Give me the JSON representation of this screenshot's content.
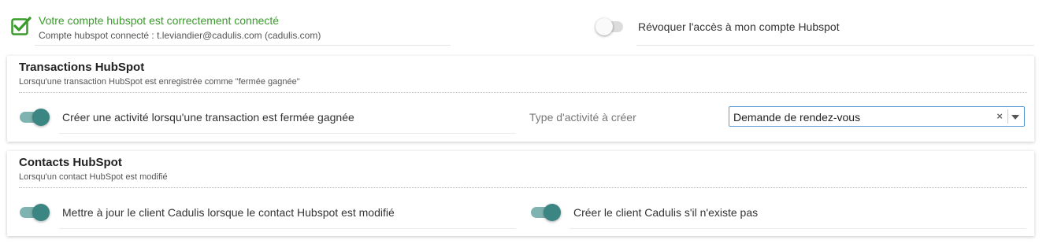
{
  "connection": {
    "status_text": "Votre compte hubspot est correctement connecté",
    "account_text": "Compte hubspot connecté : t.leviandier@cadulis.com (cadulis.com)",
    "status_color": "#3a9a2c",
    "revoke_label": "Révoquer l'accès à mon compte Hubspot",
    "revoke_toggle_on": false
  },
  "transactions": {
    "title": "Transactions HubSpot",
    "subtitle": "Lorsqu'une transaction HubSpot est enregistrée comme \"fermée gagnée\"",
    "create_activity_label": "Créer une activité lorsqu'une transaction est fermée gagnée",
    "create_activity_on": true,
    "activity_type_label": "Type d'activité à créer",
    "activity_type_value": "Demande de rendez-vous",
    "clear_icon": "close-icon",
    "dropdown_icon": "chevron-down-icon"
  },
  "contacts": {
    "title": "Contacts HubSpot",
    "subtitle": "Lorsqu'un contact HubSpot est modifié",
    "update_client_label": "Mettre à jour le client Cadulis lorsque le contact Hubspot est modifié",
    "update_client_on": true,
    "create_client_label": "Créer le client Cadulis s'il n'existe pas",
    "create_client_on": true
  },
  "colors": {
    "toggle_on_knob": "#3b8583",
    "toggle_on_track": "#7fb3b1",
    "select_border": "#5b9bd5"
  }
}
